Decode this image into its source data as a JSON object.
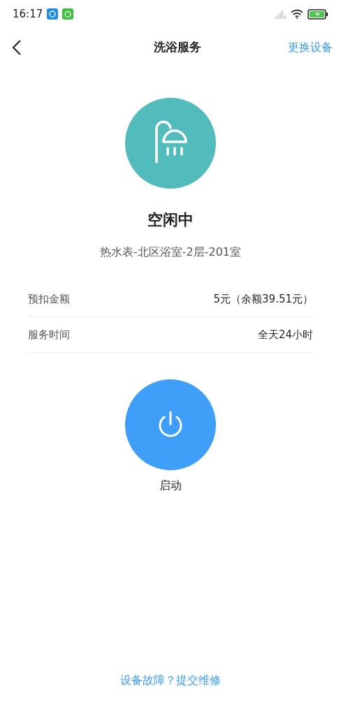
{
  "status_bar": {
    "time": "16:17"
  },
  "header": {
    "title": "洗浴服务",
    "action": "更换设备"
  },
  "device": {
    "status": "空闲中",
    "location": "热水表-北区浴室-2层-201室"
  },
  "details": [
    {
      "label": "预扣金额",
      "value": "5元（余额39.51元）"
    },
    {
      "label": "服务时间",
      "value": "全天24小时"
    }
  ],
  "power_button": {
    "label": "启动"
  },
  "footer_link": "设备故障？提交维修"
}
